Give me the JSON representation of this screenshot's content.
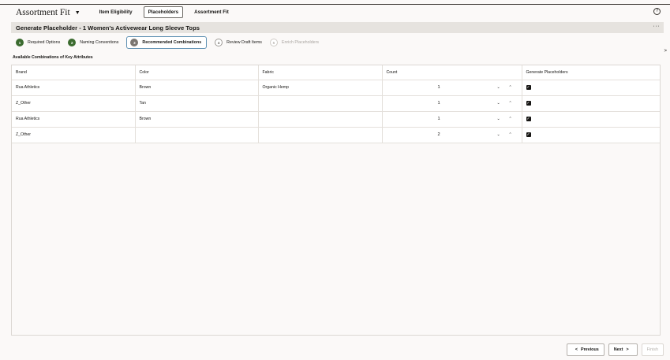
{
  "header": {
    "app_title": "Assortment Fit",
    "nav_tabs": [
      {
        "label": "Item Eligibility"
      },
      {
        "label": "Placeholders"
      },
      {
        "label": "Assortment Fit"
      }
    ],
    "help_icon": "help-icon"
  },
  "page": {
    "title": "Generate Placeholder - 1 Women's Activewear Long Sleeve Tops",
    "more_icon": "···"
  },
  "train": [
    {
      "num": "1",
      "label": "Required Options",
      "state": "done"
    },
    {
      "num": "2",
      "label": "Naming Conventions",
      "state": "done"
    },
    {
      "num": "3",
      "label": "Recommended Combinations",
      "state": "current"
    },
    {
      "num": "4",
      "label": "Review Draft Items",
      "state": "todo"
    },
    {
      "num": "5",
      "label": "Enrich Placeholders",
      "state": "disabled"
    }
  ],
  "section_label": "Available Combinations of Key Attributes",
  "table": {
    "columns": [
      "Brand",
      "Color",
      "Fabric",
      "Count",
      "Generate Placeholders"
    ],
    "rows": [
      {
        "brand": "Rua Athletics",
        "color": "Brown",
        "fabric": "Organic Hemp",
        "count": "1",
        "generate": true
      },
      {
        "brand": "Z_Other",
        "color": "Tan",
        "fabric": "",
        "count": "1",
        "generate": true
      },
      {
        "brand": "Rua Athletics",
        "color": "Brown",
        "fabric": "",
        "count": "1",
        "generate": true
      },
      {
        "brand": "Z_Other",
        "color": "",
        "fabric": "",
        "count": "2",
        "generate": true
      }
    ]
  },
  "footer": {
    "previous": "Previous",
    "next": "Next",
    "finish": "Finish"
  },
  "colors": {
    "accent_green": "#3b6b2f",
    "current_border": "#5f91b3"
  }
}
